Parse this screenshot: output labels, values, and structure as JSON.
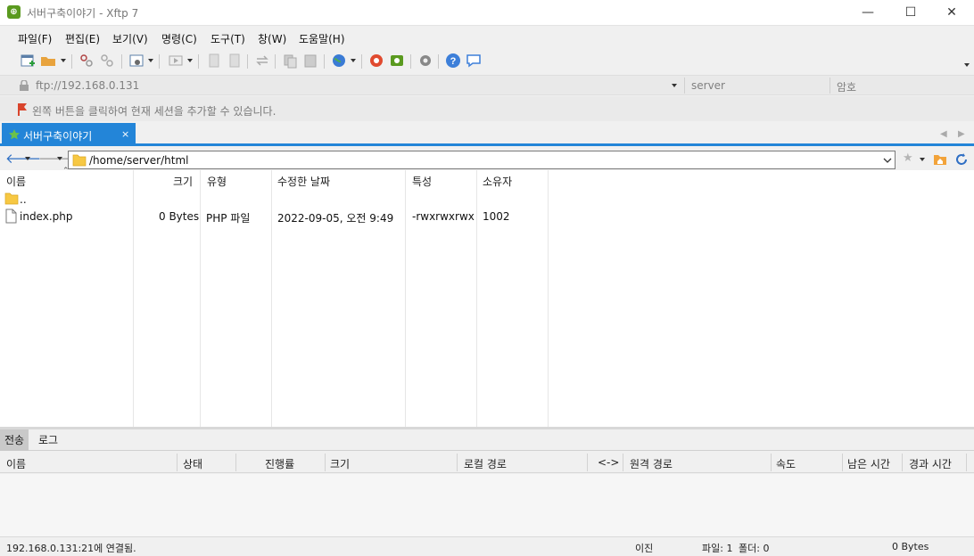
{
  "window": {
    "title": "서버구축이야기 - Xftp 7",
    "app_icon_glyph": "⊕",
    "minimize_glyph": "—",
    "maximize_glyph": "☐",
    "close_glyph": "✕"
  },
  "menu": {
    "file": "파일(F)",
    "edit": "편집(E)",
    "view": "보기(V)",
    "commands": "명령(C)",
    "tools": "도구(T)",
    "window": "창(W)",
    "help": "도움말(H)"
  },
  "address": {
    "url": "ftp://192.168.0.131",
    "username_placeholder": "server",
    "password_placeholder": "암호"
  },
  "hint": {
    "text": "왼쪽 버튼을 클릭하여 현재 세션을 추가할 수 있습니다."
  },
  "session_tab": {
    "label": "서버구축이야기",
    "close": "×"
  },
  "path": {
    "current": "/home/server/html"
  },
  "file_list": {
    "columns": {
      "name": "이름",
      "size": "크기",
      "type": "유형",
      "modified": "수정한 날짜",
      "attributes": "특성",
      "owner": "소유자"
    },
    "rows": [
      {
        "name": "..",
        "size": "",
        "type": "",
        "modified": "",
        "attributes": "",
        "owner": ""
      },
      {
        "name": "index.php",
        "size": "0 Bytes",
        "type": "PHP 파일",
        "modified": "2022-09-05, 오전 9:49",
        "attributes": "-rwxrwxrwx",
        "owner": "1002"
      }
    ]
  },
  "transfer_panel": {
    "tabs": {
      "transfer": "전송",
      "log": "로그"
    },
    "columns": {
      "name": "이름",
      "status": "상태",
      "progress": "진행률",
      "size": "크기",
      "local_path": "로컬 경로",
      "direction": "<->",
      "remote_path": "원격 경로",
      "speed": "속도",
      "remaining": "남은 시간",
      "elapsed": "경과 시간"
    }
  },
  "status": {
    "connection": "192.168.0.131:21에 연결됨.",
    "mode": "이진",
    "file_count": "파일: 1",
    "folder_count": "폴더: 0",
    "total_size": "0 Bytes"
  },
  "colors": {
    "accent": "#2385d8",
    "folder": "#f7c843",
    "app_icon": "#5a9a1f"
  }
}
